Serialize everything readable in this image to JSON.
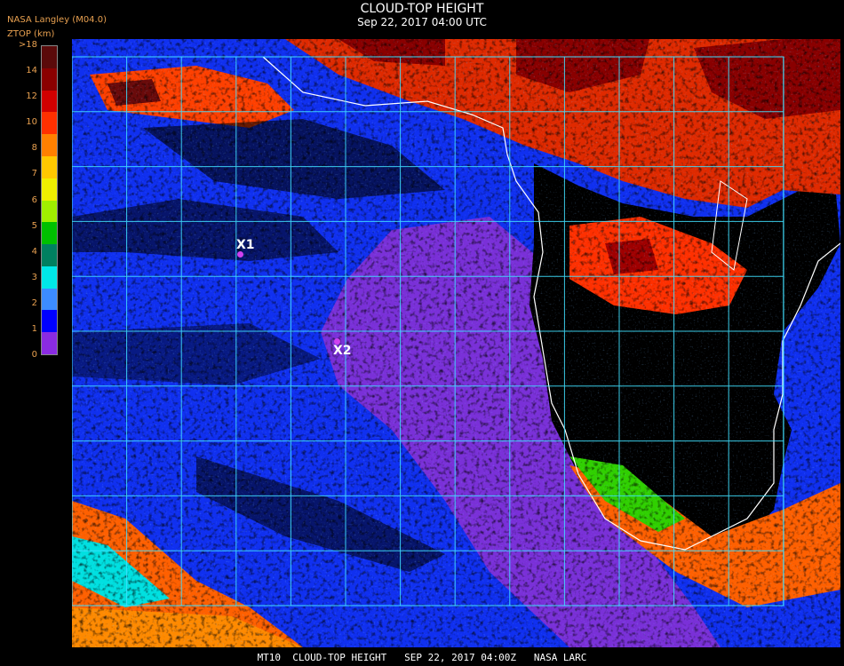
{
  "title": "CLOUD-TOP HEIGHT",
  "subtitle": "Sep 22, 2017 04:00 UTC",
  "source": "NASA Langley (M04.0)",
  "units": "ZTOP (km)",
  "legend": {
    "labels": [
      ">18",
      "14",
      "12",
      "10",
      "8",
      "7",
      "6",
      "5",
      "4",
      "3",
      "2",
      "1",
      "0"
    ],
    "colors": [
      "#5a0a0a",
      "#8a0000",
      "#d10000",
      "#ff3000",
      "#ff8000",
      "#ffc800",
      "#f0f000",
      "#a0f000",
      "#00c000",
      "#008060",
      "#00e8e8",
      "#3c8cff",
      "#0000ff",
      "#8a2be2"
    ]
  },
  "markers": [
    {
      "label": "X1",
      "color": "#d040f0"
    },
    {
      "label": "X2",
      "color": "#d040f0"
    }
  ],
  "footer": "MT10  CLOUD-TOP HEIGHT   SEP 22, 2017 04:00Z   NASA LARC",
  "grid_color": "#40e0ff",
  "coast_color": "#ffffff"
}
